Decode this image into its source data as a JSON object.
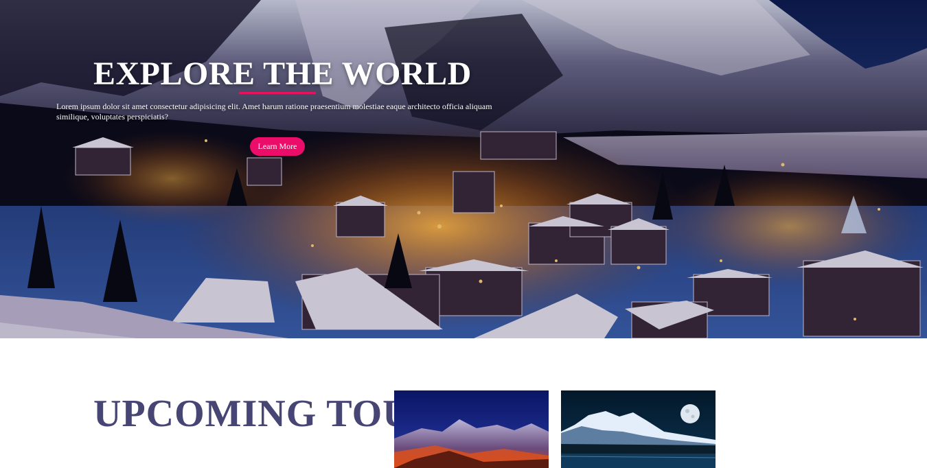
{
  "hero": {
    "title": "EXPLORE THE WORLD",
    "description": "Lorem ipsum dolor sit amet consectetur adipisicing elit. Amet harum ratione praesentium molestiae eaque architecto officia aliquam similique, voluptates perspiciatis?",
    "button_label": "Learn More",
    "accent_color": "#ec0d6a",
    "background_image": "snowy-mountain-village-night"
  },
  "section": {
    "heading": "UPCOMING TOURS &",
    "heading_color": "#464573"
  },
  "tours": [
    {
      "image": "red-lit-snowy-mountain-night"
    },
    {
      "image": "moonlit-snowy-mountain-lake"
    }
  ]
}
